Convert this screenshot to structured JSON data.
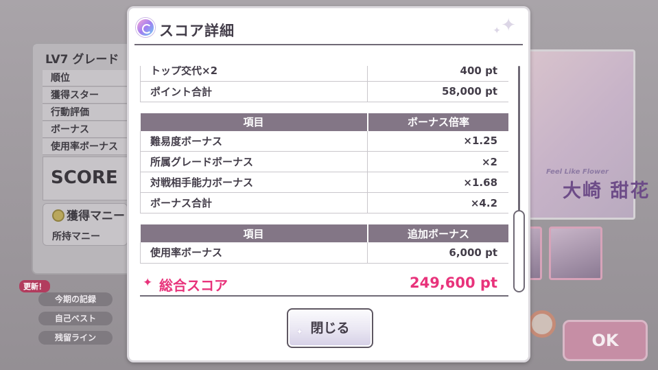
{
  "background": {
    "title": "LV7 グレード",
    "rows": [
      "順位",
      "獲得スター",
      "行動評価",
      "ボーナス",
      "使用率ボーナス"
    ],
    "score_label": "SCORE",
    "money_title": "獲得マニー",
    "money_row": "所持マニー",
    "new_badge": "更新！",
    "pills": [
      "今期の記録",
      "自己ベスト",
      "残留ライン"
    ],
    "card_name": "大崎 甜花",
    "card_subtitle": "Feel Like Flower",
    "ok_label": "OK"
  },
  "dialog": {
    "title": "スコア詳細",
    "score_rows": [
      {
        "label": "トップ交代×2",
        "value": "400 pt"
      },
      {
        "label": "ポイント合計",
        "value": "58,000 pt"
      }
    ],
    "bonus_table": {
      "headers": [
        "項目",
        "ボーナス倍率"
      ],
      "rows": [
        {
          "label": "難易度ボーナス",
          "value": "×1.25"
        },
        {
          "label": "所属グレードボーナス",
          "value": "×2"
        },
        {
          "label": "対戦相手能力ボーナス",
          "value": "×1.68"
        },
        {
          "label": "ボーナス合計",
          "value": "×4.2"
        }
      ]
    },
    "extra_table": {
      "headers": [
        "項目",
        "追加ボーナス"
      ],
      "rows": [
        {
          "label": "使用率ボーナス",
          "value": "6,000 pt"
        }
      ]
    },
    "total": {
      "label": "総合スコア",
      "value": "249,600 pt"
    },
    "close_label": "閉じる"
  },
  "colors": {
    "accent_pink": "#e8337b",
    "header_bg": "#837686",
    "text_dark": "#433d49"
  },
  "icons": {
    "logo": "shiny-logo-icon",
    "sparkle": "sparkle-icon",
    "total_star": "star-sparkle-icon"
  }
}
